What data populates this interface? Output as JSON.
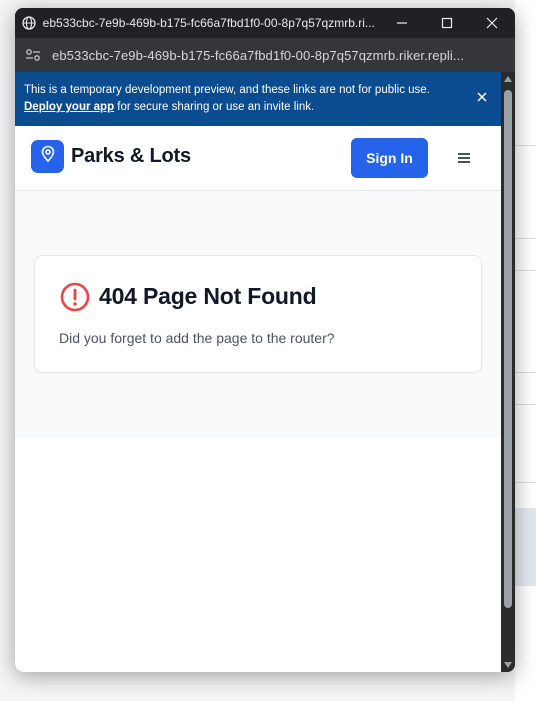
{
  "window": {
    "title": "eb533cbc-7e9b-469b-b175-fc66a7fbd1f0-00-8p7q57qzmrb.ri...",
    "url": "eb533cbc-7e9b-469b-b175-fc66a7fbd1f0-00-8p7q57qzmrb.riker.repli..."
  },
  "banner": {
    "line1": "This is a temporary development preview, and these links are not for public use.",
    "deploy_link": "Deploy your app",
    "line2_rest": " for secure sharing or use an invite link."
  },
  "navbar": {
    "brand": "Parks & Lots",
    "signin_label": "Sign In"
  },
  "error": {
    "title": "404 Page Not Found",
    "message": "Did you forget to add the page to the router?"
  },
  "colors": {
    "accent": "#2563eb",
    "banner": "#0b4b8f",
    "error_icon": "#ef4444"
  },
  "icons": [
    "globe-icon",
    "minimize-icon",
    "maximize-icon",
    "close-icon",
    "site-settings-icon",
    "map-pin-icon",
    "menu-icon",
    "alert-circle-icon"
  ]
}
